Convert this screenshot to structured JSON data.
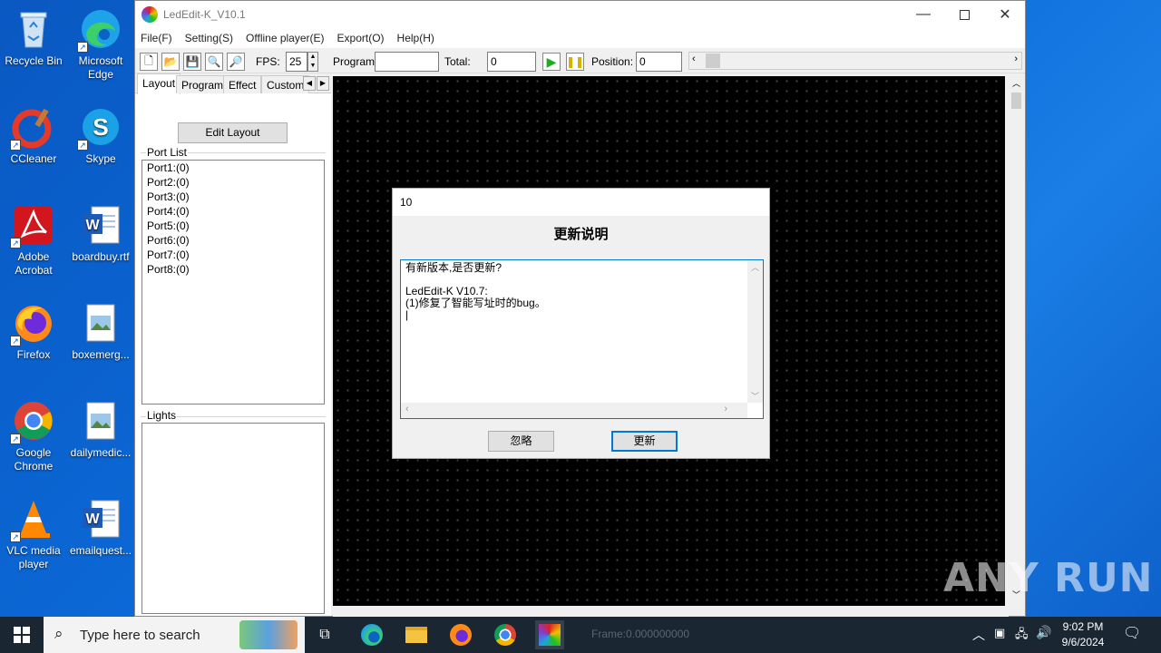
{
  "desktop": {
    "icons": [
      {
        "label": "Recycle Bin"
      },
      {
        "label": "Microsoft Edge"
      },
      {
        "label": "CCleaner"
      },
      {
        "label": "Skype"
      },
      {
        "label": "Adobe Acrobat"
      },
      {
        "label": "boardbuy.rtf"
      },
      {
        "label": "Firefox"
      },
      {
        "label": "boxemerg..."
      },
      {
        "label": "Google Chrome"
      },
      {
        "label": "dailymedic..."
      },
      {
        "label": "VLC media player"
      },
      {
        "label": "emailquest..."
      }
    ]
  },
  "window": {
    "title": "LedEdit-K_V10.1",
    "menu": [
      "File(F)",
      "Setting(S)",
      "Offline player(E)",
      "Export(O)",
      "Help(H)"
    ],
    "toolbar": {
      "fps_label": "FPS:",
      "fps_value": "25",
      "program_label": "Program:",
      "program_value": "",
      "total_label": "Total:",
      "total_value": "0",
      "position_label": "Position:",
      "position_value": "0"
    },
    "tabs": [
      "Layout",
      "Program",
      "Effect",
      "Custom"
    ],
    "edit_layout_label": "Edit Layout",
    "port_list_label": "Port List",
    "ports": [
      "Port1:(0)",
      "Port2:(0)",
      "Port3:(0)",
      "Port4:(0)",
      "Port5:(0)",
      "Port6:(0)",
      "Port7:(0)",
      "Port8:(0)"
    ],
    "lights_label": "Lights"
  },
  "dialog": {
    "title": "10",
    "heading": "更新说明",
    "body": "有新版本,是否更新?\n\nLedEdit-K V10.7:\n(1)修复了智能写址时的bug。\n|",
    "ignore_label": "忽略",
    "update_label": "更新"
  },
  "taskbar": {
    "search_placeholder": "Type here to search",
    "time": "9:02 PM",
    "date": "9/6/2024",
    "status_hint": "Frame:0.000000000"
  },
  "watermark": "ANY RUN"
}
